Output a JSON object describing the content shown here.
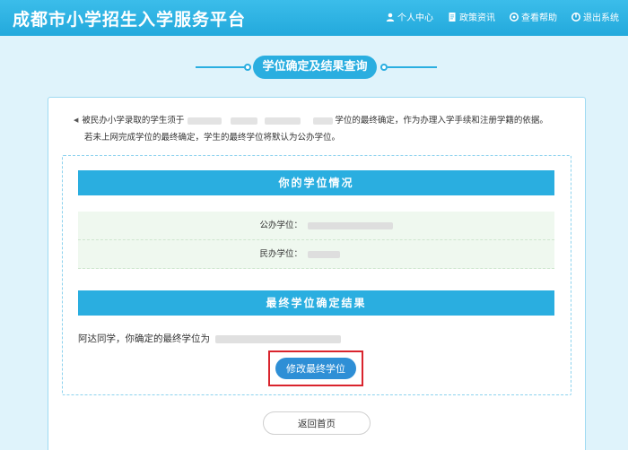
{
  "header": {
    "site_title": "成都市小学招生入学服务平台",
    "nav": [
      {
        "label": "个人中心",
        "icon": "user-icon"
      },
      {
        "label": "政策资讯",
        "icon": "document-icon"
      },
      {
        "label": "查看帮助",
        "icon": "help-icon"
      },
      {
        "label": "退出系统",
        "icon": "power-icon"
      }
    ]
  },
  "section": {
    "title": "学位确定及结果查询"
  },
  "notice": {
    "line1_start": "被民办小学录取的学生须于",
    "line1_end": "学位的最终确定，作为办理入学手续和注册学籍的依据。",
    "line2": "若未上网完成学位的最终确定，学生的最终学位将默认为公办学位。"
  },
  "status": {
    "heading": "你的学位情况",
    "public_label": "公办学位：",
    "private_label": "民办学位："
  },
  "result": {
    "heading": "最终学位确定结果",
    "text": "阿达同学，你确定的最终学位为"
  },
  "actions": {
    "modify_label": "修改最终学位",
    "home_label": "返回首页"
  },
  "colors": {
    "primary": "#2aaee0",
    "button": "#2e8fd6",
    "highlight": "#d9242d",
    "row_bg": "#eff8ef"
  }
}
